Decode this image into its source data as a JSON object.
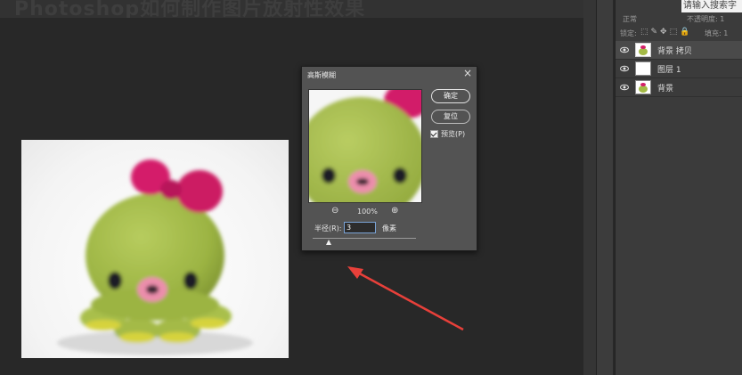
{
  "watermark_title": "Photoshop如何制作图片放射性效果",
  "dialog": {
    "title": "高斯模糊",
    "ok_label": "确定",
    "reset_label": "复位",
    "preview_label": "预览(P)",
    "preview_checked": true,
    "zoom_level": "100%",
    "radius_label": "半径(R):",
    "radius_value": "3",
    "radius_unit": "像素",
    "close_icon": "close-icon"
  },
  "layers_panel": {
    "search_placeholder": "请输入搜索字",
    "blend_mode": "正常",
    "opacity_label": "不透明度: 1",
    "lock_label": "锁定:",
    "fill_label": "填充: 1",
    "layers": [
      {
        "name": "背景 拷贝",
        "selected": true
      },
      {
        "name": "图层 1",
        "selected": false
      },
      {
        "name": "背景",
        "selected": false
      }
    ]
  },
  "annotation_color": "#e8403a"
}
